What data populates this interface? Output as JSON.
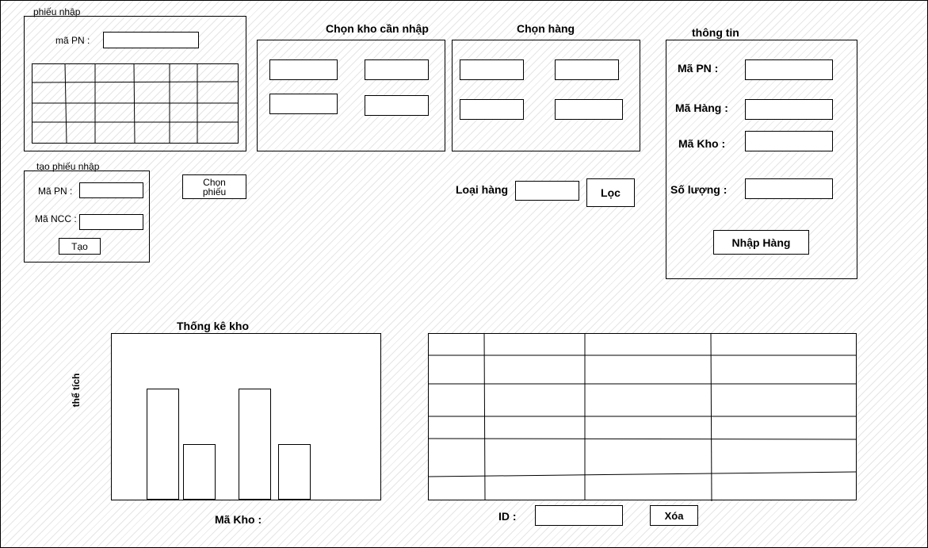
{
  "phieu_nhap": {
    "title": "phiếu nhập",
    "ma_pn_label": "mã PN :",
    "ma_pn_value": ""
  },
  "tao_phieu_nhap": {
    "title": "tạo phiếu nhập",
    "ma_pn_label": "Mã PN :",
    "ma_pn_value": "",
    "ma_ncc_label": "Mã NCC :",
    "ma_ncc_value": "",
    "tao_button": "Tạo"
  },
  "chon_phieu_button": "Chọn phiếu",
  "chon_kho": {
    "title": "Chọn kho cần nhập",
    "options": [
      "",
      "",
      "",
      ""
    ]
  },
  "chon_hang": {
    "title": "Chọn hàng",
    "options": [
      "",
      "",
      "",
      ""
    ]
  },
  "filter": {
    "loai_hang_label": "Loại hàng",
    "loai_hang_value": "",
    "loc_button": "Lọc"
  },
  "thong_tin": {
    "title": "thông tin",
    "ma_pn_label": "Mã PN :",
    "ma_pn_value": "",
    "ma_hang_label": "Mã Hàng :",
    "ma_hang_value": "",
    "ma_kho_label": "Mã Kho :",
    "ma_kho_value": "",
    "so_luong_label": "Số lượng :",
    "so_luong_value": "",
    "nhap_hang_button": "Nhập Hàng"
  },
  "chart_data": {
    "type": "bar",
    "title": "Thống kê kho",
    "xlabel": "Mã Kho :",
    "ylabel": "thể tích",
    "categories": [
      "",
      "",
      "",
      ""
    ],
    "values": [
      1.0,
      0.5,
      1.0,
      0.5
    ],
    "grid": false
  },
  "bottom": {
    "id_label": "ID :",
    "id_value": "",
    "xoa_button": "Xóa"
  }
}
